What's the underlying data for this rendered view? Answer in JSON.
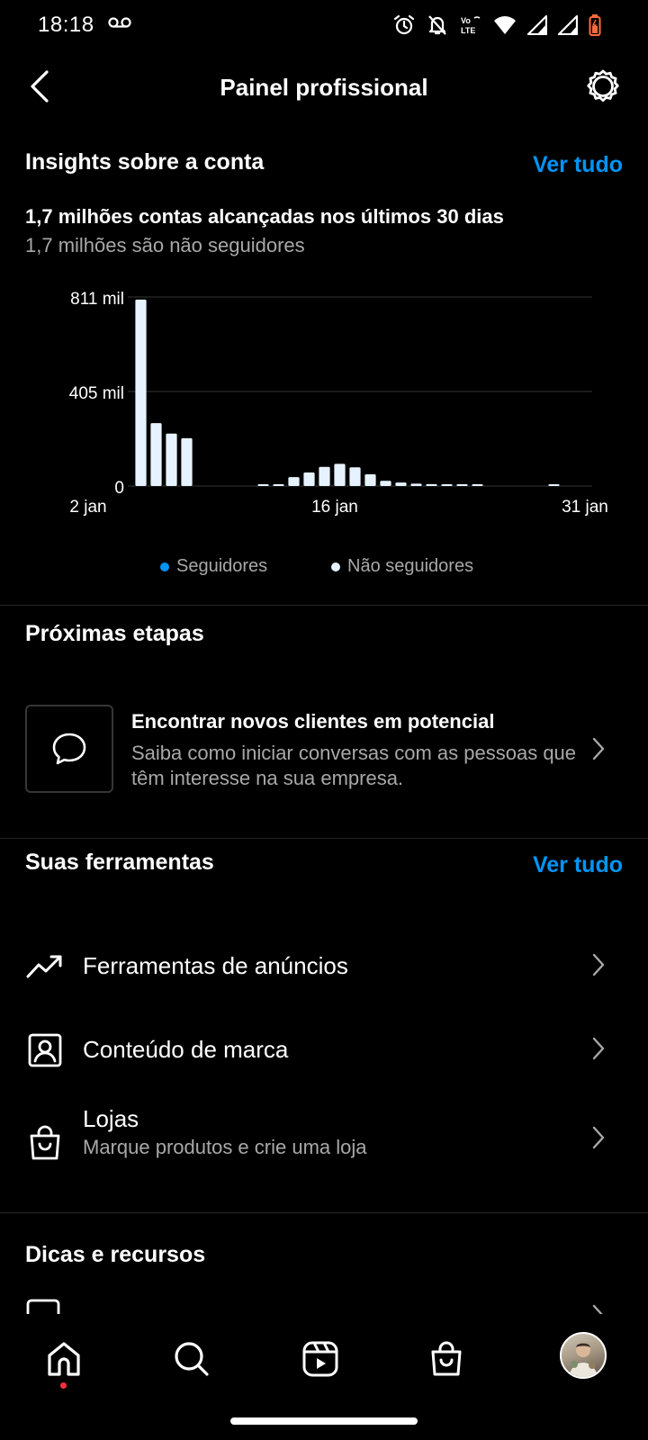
{
  "status_bar": {
    "time": "18:18"
  },
  "header": {
    "title": "Painel profissional"
  },
  "insights": {
    "title": "Insights sobre a conta",
    "see_all": "Ver tudo",
    "reach_main": "1,7 milhões contas alcançadas nos últimos 30 dias",
    "reach_sub": "1,7 milhões são não seguidores"
  },
  "chart_data": {
    "type": "bar",
    "y_tick_labels": [
      "811 mil",
      "405 mil",
      "0"
    ],
    "x_tick_labels": [
      "2 jan",
      "16 jan",
      "31 jan"
    ],
    "ylim": [
      0,
      811000
    ],
    "grid": true,
    "legend_position": "bottom",
    "days": [
      "2 jan",
      "3 jan",
      "4 jan",
      "5 jan",
      "6 jan",
      "7 jan",
      "8 jan",
      "9 jan",
      "10 jan",
      "11 jan",
      "12 jan",
      "13 jan",
      "14 jan",
      "15 jan",
      "16 jan",
      "17 jan",
      "18 jan",
      "19 jan",
      "20 jan",
      "21 jan",
      "22 jan",
      "23 jan",
      "24 jan",
      "25 jan",
      "26 jan",
      "27 jan",
      "28 jan",
      "29 jan",
      "30 jan",
      "31 jan"
    ],
    "series": [
      {
        "name": "Seguidores",
        "color": "#0095f6",
        "values": [
          0,
          0,
          0,
          0,
          0,
          0,
          0,
          0,
          0,
          0,
          0,
          0,
          0,
          0,
          0,
          0,
          0,
          0,
          0,
          0,
          0,
          0,
          0,
          0,
          0,
          0,
          0,
          0,
          0,
          0
        ]
      },
      {
        "name": "Não seguidores",
        "color": "#e6f2ff",
        "values": [
          800000,
          270000,
          225000,
          205000,
          0,
          0,
          0,
          0,
          3000,
          4000,
          38000,
          58000,
          82000,
          95000,
          80000,
          50000,
          22000,
          15000,
          10000,
          8000,
          6000,
          5000,
          4000,
          0,
          0,
          0,
          0,
          3000,
          0,
          0
        ]
      }
    ]
  },
  "next_steps": {
    "title": "Próximas etapas",
    "card_title": "Encontrar novos clientes em potencial",
    "card_desc": "Saiba como iniciar conversas com as pessoas que têm interesse na sua empresa."
  },
  "tools": {
    "title": "Suas ferramentas",
    "see_all": "Ver tudo",
    "items": [
      {
        "label": "Ferramentas de anúncios",
        "icon": "trending-up-icon"
      },
      {
        "label": "Conteúdo de marca",
        "icon": "person-badge-icon"
      },
      {
        "label": "Lojas",
        "sub": "Marque produtos e crie uma loja",
        "icon": "shopping-bag-icon"
      }
    ]
  },
  "tips": {
    "title": "Dicas e recursos"
  }
}
